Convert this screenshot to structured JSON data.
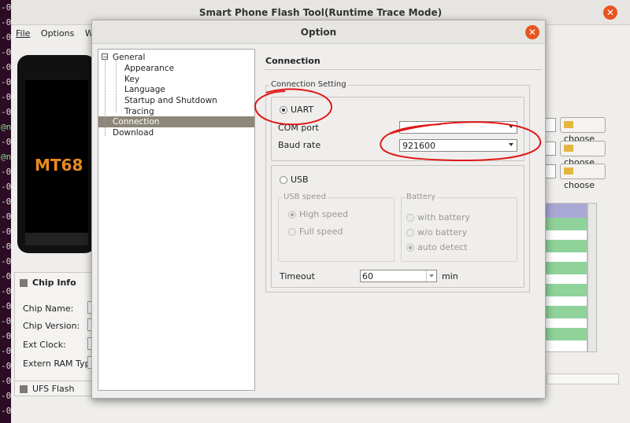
{
  "terminal": {
    "lines": [
      "-0",
      "-0",
      "-0",
      "-0",
      "-0",
      "-0",
      "-0",
      "-0",
      "@n",
      "-0",
      "@n",
      "-0",
      "-0",
      "-0",
      "-0",
      "-0",
      "-0",
      "-0",
      "-0",
      "-0",
      "-0",
      "-0",
      "-0",
      "-0",
      "-0",
      "-0",
      "-0",
      "-0"
    ]
  },
  "main": {
    "title": "Smart Phone Flash Tool(Runtime Trace Mode)",
    "menu": {
      "file": "File",
      "options": "Options",
      "window": "Wind"
    },
    "phone_model": "MT68",
    "chip_info": {
      "header": "Chip Info",
      "chip_name": "Chip Name:",
      "chip_version": "Chip Version:",
      "ext_clock": "Ext Clock:",
      "extern_ram": "Extern RAM Type:",
      "ufs_flash": "UFS Flash"
    },
    "choose_label": "choose"
  },
  "dialog": {
    "title": "Option",
    "tree": {
      "general": "General",
      "appearance": "Appearance",
      "key": "Key",
      "language": "Language",
      "startup": "Startup and Shutdown",
      "tracing": "Tracing",
      "connection": "Connection",
      "download": "Download"
    },
    "section_title": "Connection",
    "connection_setting": "Connection Setting",
    "uart": "UART",
    "com_port": "COM port",
    "com_port_value": "",
    "baud_rate": "Baud rate",
    "baud_rate_value": "921600",
    "usb": "USB",
    "usb_speed": "USB speed",
    "high_speed": "High speed",
    "full_speed": "Full speed",
    "battery": "Battery",
    "with_battery": "with battery",
    "wo_battery": "w/o battery",
    "auto_detect": "auto detect",
    "timeout": "Timeout",
    "timeout_value": "60",
    "timeout_unit": "min"
  },
  "colors": {
    "accent": "#e95420",
    "selection": "#8c8778",
    "annotation": "#e01818"
  }
}
